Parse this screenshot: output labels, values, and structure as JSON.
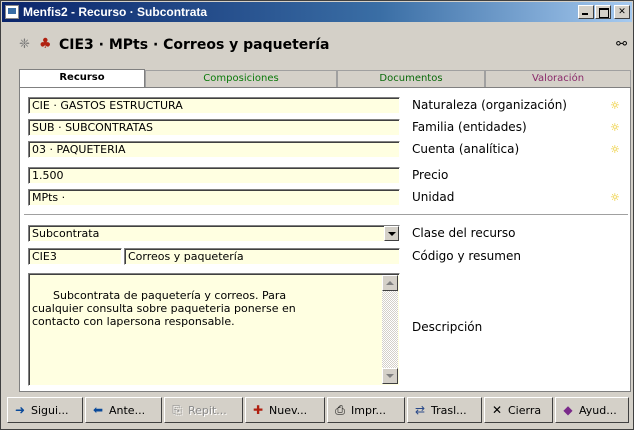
{
  "window": {
    "title": "Menfis2 - Recurso · Subcontrata"
  },
  "header": {
    "title": "CIE3 · MPts · Correos y paquetería",
    "icon1": "pattern-icon",
    "icon2": "resource-icon",
    "find_icon": "binoculars-icon"
  },
  "tabs": [
    {
      "label": "Recurso",
      "active": true
    },
    {
      "label": "Composiciones",
      "active": false
    },
    {
      "label": "Documentos",
      "active": false
    },
    {
      "label": "Valoración",
      "active": false
    }
  ],
  "fields": {
    "naturaleza": {
      "value": "CIE · GASTOS ESTRUCTURA",
      "label": "Naturaleza (organización)"
    },
    "familia": {
      "value": "SUB · SUBCONTRATAS",
      "label": "Familia (entidades)"
    },
    "cuenta": {
      "value": "03 · PAQUETERIA",
      "label": "Cuenta (analítica)"
    },
    "precio": {
      "value": "1.500",
      "label": "Precio"
    },
    "unidad": {
      "value": "MPts ·",
      "label": "Unidad"
    },
    "clase": {
      "value": "Subcontrata",
      "label": "Clase del recurso"
    },
    "codigo": {
      "value": "CIE3",
      "summary": "Correos y paquetería",
      "label": "Código y resumen"
    },
    "descripcion": {
      "value": "Subcontrata de paquetería y correos. Para\ncualquier consulta sobre paqueteria ponerse en\ncontacto con lapersona responsable.",
      "label": "Descripción"
    }
  },
  "star_glyph": "☼",
  "toolbar": {
    "next": {
      "label": "Sigui...",
      "icon": "arrow-right-icon",
      "glyph": "➜"
    },
    "prev": {
      "label": "Ante...",
      "icon": "arrow-left-icon",
      "glyph": "⬅"
    },
    "repeat": {
      "label": "Repit...",
      "icon": "repeat-icon",
      "glyph": "⎘"
    },
    "new": {
      "label": "Nuev...",
      "icon": "new-resource-icon",
      "glyph": "✚"
    },
    "print": {
      "label": "Impr...",
      "icon": "printer-icon",
      "glyph": "⎙"
    },
    "transfer": {
      "label": "Trasl...",
      "icon": "transfer-icon",
      "glyph": "⇄"
    },
    "close": {
      "label": "Cierra",
      "icon": "close-icon",
      "glyph": "✕"
    },
    "help": {
      "label": "Ayud...",
      "icon": "help-book-icon",
      "glyph": "◆"
    }
  }
}
